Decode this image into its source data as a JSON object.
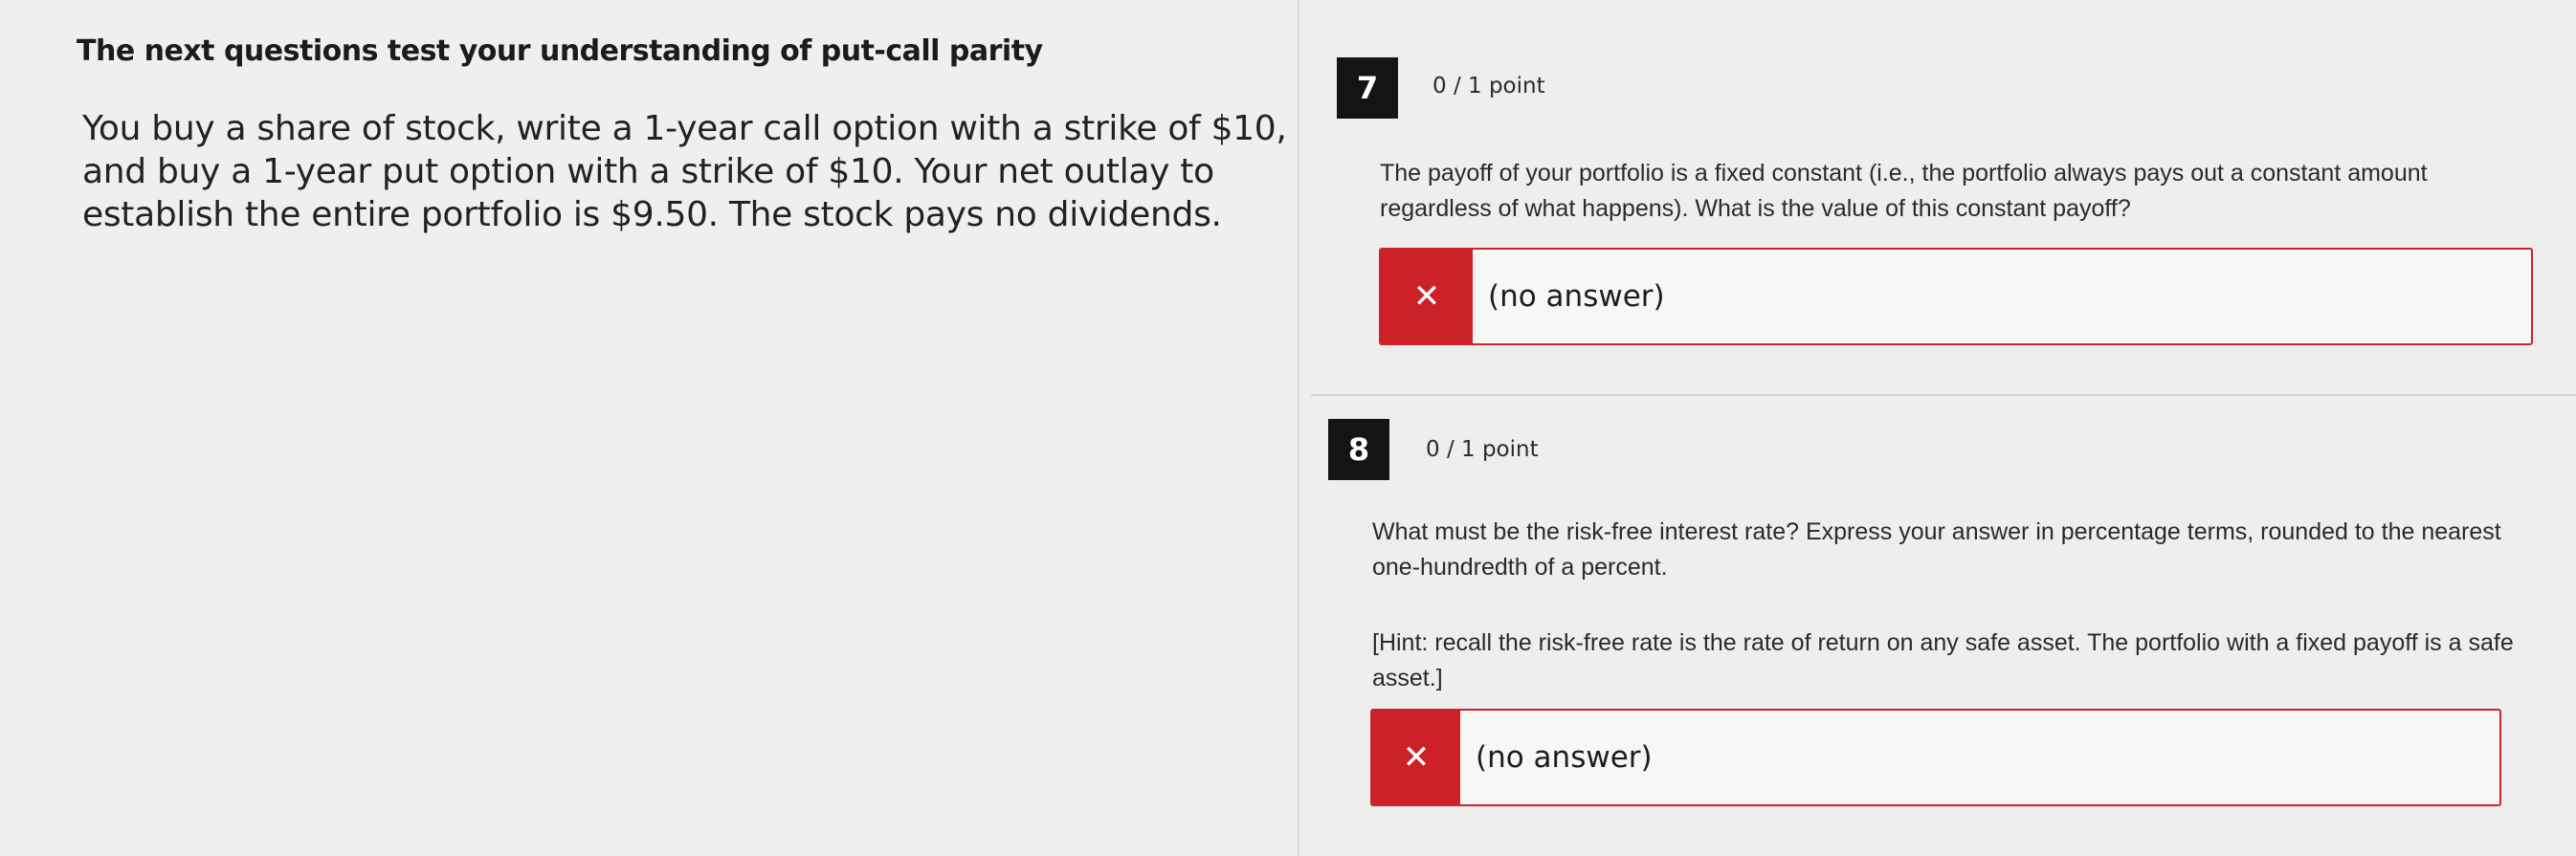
{
  "context": {
    "heading": "The next questions test your understanding of put-call parity",
    "text": "You buy a share of stock, write a 1-year call option with a strike of $10, and buy a 1-year put option with a strike of $10. Your net outlay to establish the entire portfolio is $9.50. The stock pays no dividends."
  },
  "questions": [
    {
      "number": "7",
      "points": "0 / 1 point",
      "text": "The payoff of your portfolio is a fixed constant (i.e., the portfolio always pays out a constant amount regardless of what happens). What is the value of this constant payoff?",
      "hint": "",
      "status_icon": "✕",
      "answer": "(no answer)"
    },
    {
      "number": "8",
      "points": "0 / 1 point",
      "text": "What must be the risk-free interest rate? Express your answer in percentage terms, rounded to the nearest one-hundredth of a percent.",
      "hint": "[Hint: recall the risk-free rate is the rate of return on any safe asset. The portfolio with a fixed payoff is a safe asset.]",
      "status_icon": "✕",
      "answer": "(no answer)"
    }
  ],
  "colors": {
    "incorrect": "#cc2129",
    "badge": "#141414"
  }
}
